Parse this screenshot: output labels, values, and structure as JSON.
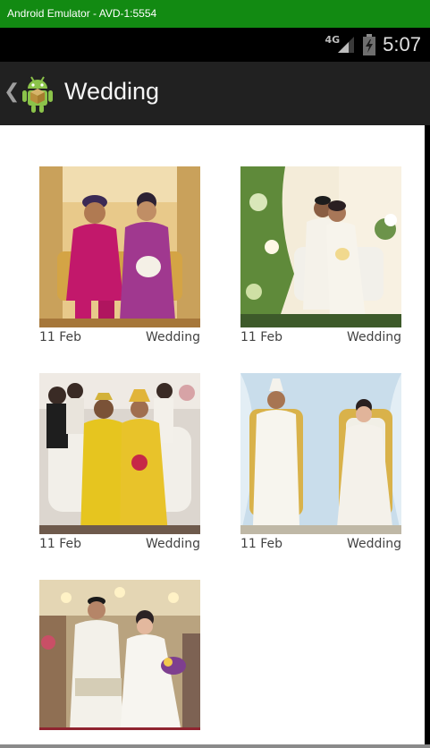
{
  "emulator": {
    "title": "Android Emulator - AVD-1:5554"
  },
  "status_bar": {
    "network": "4G",
    "time": "5:07"
  },
  "action_bar": {
    "title": "Wedding"
  },
  "gallery": {
    "items": [
      {
        "date": "11 Feb",
        "category": "Wedding"
      },
      {
        "date": "11 Feb",
        "category": "Wedding"
      },
      {
        "date": "11 Feb",
        "category": "Wedding"
      },
      {
        "date": "11 Feb",
        "category": "Wedding"
      },
      {
        "date": "",
        "category": ""
      }
    ]
  },
  "colors": {
    "emulator_bar": "#128a12",
    "action_bar": "#212121",
    "caption_text": "#424242"
  }
}
